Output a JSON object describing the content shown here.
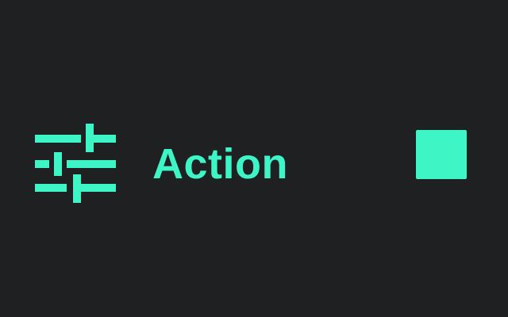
{
  "action_row": {
    "icon": "sliders-adjust-icon",
    "label": "Action",
    "accent_color": "#3df5c5",
    "background_color": "#1f2022"
  }
}
